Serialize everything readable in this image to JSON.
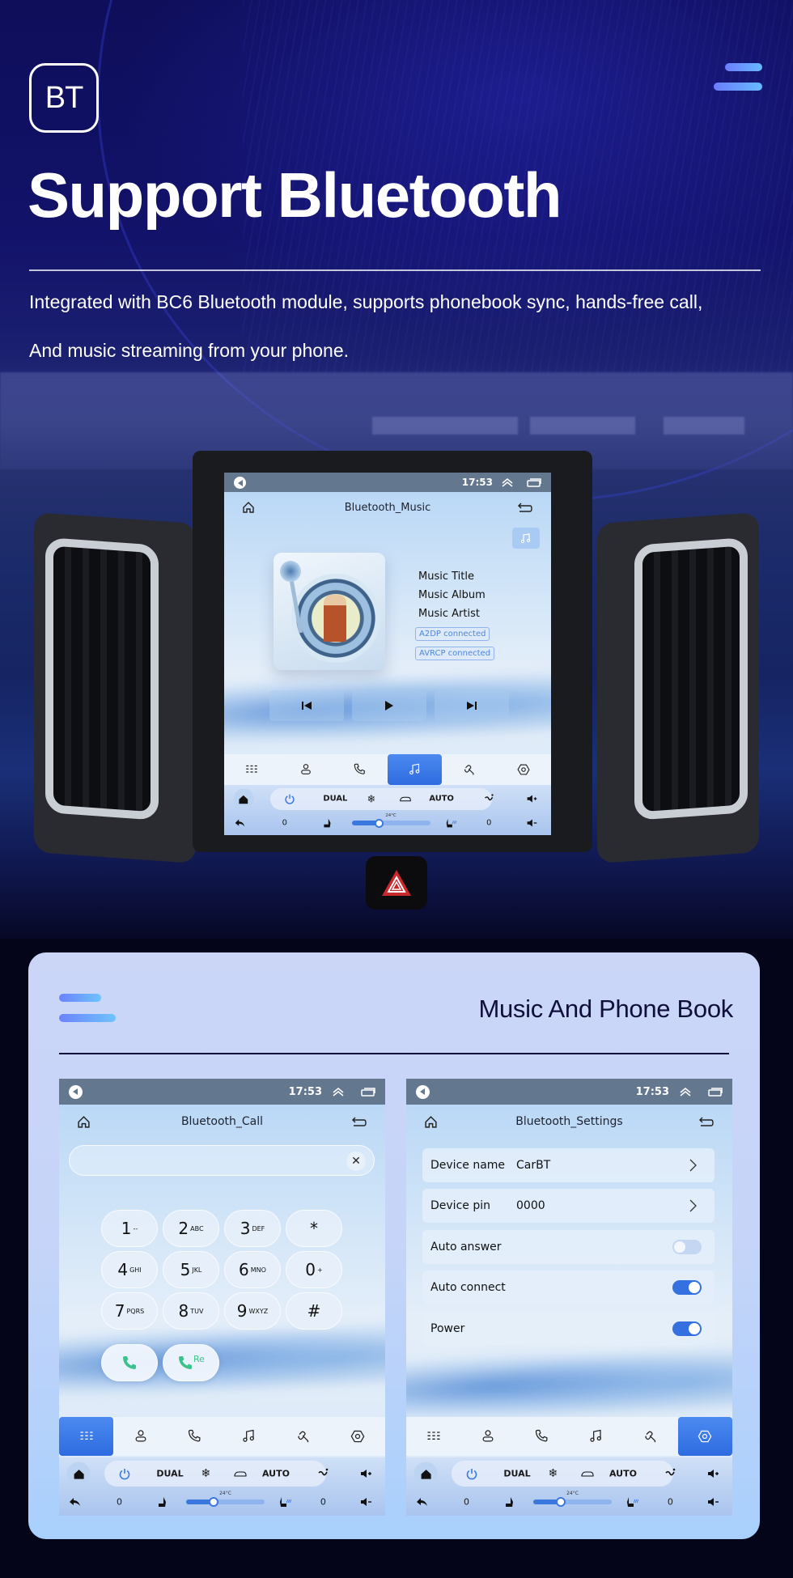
{
  "hero": {
    "badge": "BT",
    "title": "Support Bluetooth",
    "description_line1": "Integrated with BC6 Bluetooth module, supports phonebook sync, hands-free call,",
    "description_line2": "And music streaming from your phone."
  },
  "status_bar": {
    "time": "17:53"
  },
  "music_screen": {
    "title": "Bluetooth_Music",
    "track": {
      "title": "Music Title",
      "album": "Music Album",
      "artist": "Music Artist"
    },
    "badges": [
      "A2DP connected",
      "AVRCP connected"
    ],
    "controls": [
      "previous",
      "play",
      "next"
    ]
  },
  "nav_tabs": [
    {
      "icon": "dialpad-icon",
      "label": "Dialpad"
    },
    {
      "icon": "contacts-icon",
      "label": "Contacts"
    },
    {
      "icon": "call-log-icon",
      "label": "Calls"
    },
    {
      "icon": "music-icon",
      "label": "Music"
    },
    {
      "icon": "link-icon",
      "label": "Pairing"
    },
    {
      "icon": "settings-icon",
      "label": "Settings"
    }
  ],
  "climate": {
    "dual_label": "DUAL",
    "auto_label": "AUTO",
    "temperature": "24°C",
    "left_seat_value": "0",
    "right_seat_value": "0",
    "fan_level": 0.35
  },
  "section": {
    "title": "Music And Phone Book"
  },
  "call_screen": {
    "title": "Bluetooth_Call",
    "input_value": "",
    "keys": [
      {
        "digit": "1",
        "letters": "--"
      },
      {
        "digit": "2",
        "letters": "ABC"
      },
      {
        "digit": "3",
        "letters": "DEF"
      },
      {
        "digit": "*",
        "letters": ""
      },
      {
        "digit": "4",
        "letters": "GHI"
      },
      {
        "digit": "5",
        "letters": "JKL"
      },
      {
        "digit": "6",
        "letters": "MNO"
      },
      {
        "digit": "0",
        "letters": "+"
      },
      {
        "digit": "7",
        "letters": "PQRS"
      },
      {
        "digit": "8",
        "letters": "TUV"
      },
      {
        "digit": "9",
        "letters": "WXYZ"
      },
      {
        "digit": "#",
        "letters": ""
      }
    ],
    "redial_label": "Re"
  },
  "settings_screen": {
    "title": "Bluetooth_Settings",
    "device_name_label": "Device name",
    "device_name_value": "CarBT",
    "device_pin_label": "Device pin",
    "device_pin_value": "0000",
    "auto_answer_label": "Auto answer",
    "auto_answer": false,
    "auto_connect_label": "Auto connect",
    "auto_connect": true,
    "power_label": "Power",
    "power": true
  }
}
